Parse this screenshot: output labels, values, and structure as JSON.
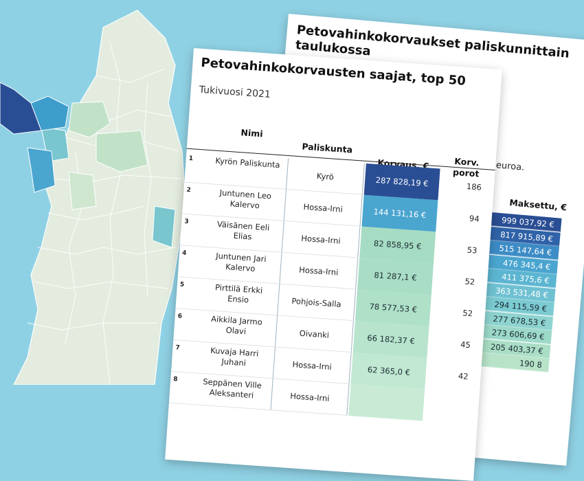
{
  "colors": {
    "sea": "#8fd1e4",
    "region_pale": "#e3ecdf",
    "region_green": "#c2e2c8",
    "region_teal": "#79c6cf",
    "region_blue": "#3e9ecb",
    "region_dark": "#2a4e94",
    "scale": [
      "#2a4e94",
      "#4aa5cf",
      "#7ccbd2",
      "#a6dcc3",
      "#c9ebd3"
    ]
  },
  "back_table": {
    "title": "Petovahinkokorvaukset paliskunnittain taulukossa",
    "note": "aa euroa.",
    "column_header": "Maksettu, €",
    "values": [
      "999 037,92 €",
      "817 915,89 €",
      "515 147,64 €",
      "476 345,4 €",
      "411 375,6 €",
      "363 531,48 €",
      "294 115,59 €",
      "277 678,53 €",
      "273 606,69 €",
      "205 403,37 €",
      "190 8"
    ]
  },
  "front_table": {
    "title": "Petovahinkokorvausten saajat, top 50",
    "subtitle": "Tukivuosi 2021",
    "headers": {
      "name": "Nimi",
      "club": "Paliskunta",
      "payment": "Korvaus, €",
      "count": "Korv. porot"
    },
    "rows": [
      {
        "rank": "1",
        "name": "Kyrön Paliskunta",
        "club": "Kyrö",
        "payment": "287 828,19 €",
        "count": "186"
      },
      {
        "rank": "2",
        "name": "Juntunen Leo Kalervo",
        "club": "Hossa-Irni",
        "payment": "144 131,16 €",
        "count": "94"
      },
      {
        "rank": "3",
        "name": "Väisänen Eeli Elias",
        "club": "Hossa-Irni",
        "payment": "82 858,95 €",
        "count": "53"
      },
      {
        "rank": "4",
        "name": "Juntunen Jari Kalervo",
        "club": "Hossa-Irni",
        "payment": "81 287,1 €",
        "count": "52"
      },
      {
        "rank": "5",
        "name": "Pirttilä Erkki Ensio",
        "club": "Pohjois-Salla",
        "payment": "78 577,53 €",
        "count": "52"
      },
      {
        "rank": "6",
        "name": "Aikkila Jarmo Olavi",
        "club": "Oivanki",
        "payment": "66 182,37 €",
        "count": "45"
      },
      {
        "rank": "7",
        "name": "Kuvaja Harri Juhani",
        "club": "Hossa-Irni",
        "payment": "62 365,0 €",
        "count": "42"
      },
      {
        "rank": "8",
        "name": "Seppänen Ville Aleksanteri",
        "club": "Hossa-Irni",
        "payment": "",
        "count": ""
      }
    ],
    "row_colors": [
      "#2a4e94",
      "#4aa5cf",
      "#a6dcc3",
      "#a9ddc5",
      "#afe0c8",
      "#b8e4cd",
      "#c1e8d2",
      "#c9ebd6"
    ]
  }
}
